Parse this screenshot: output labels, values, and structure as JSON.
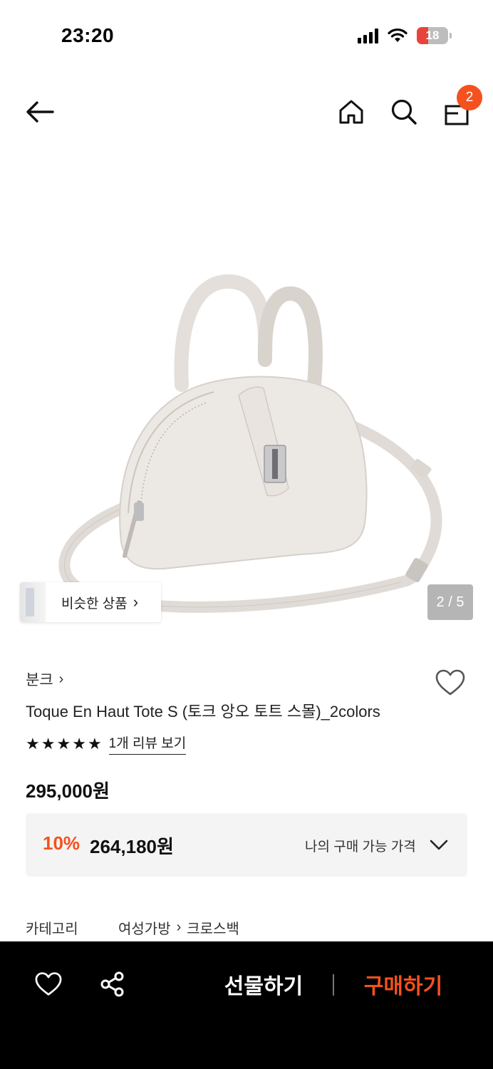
{
  "status_bar": {
    "time": "23:20",
    "battery_level": "18",
    "icons": [
      "cellular-signal-icon",
      "wifi-icon",
      "battery-icon"
    ]
  },
  "top_nav": {
    "icons": [
      "back-arrow-icon",
      "home-icon",
      "search-icon",
      "shopping-bag-icon"
    ],
    "cart_count": "2"
  },
  "gallery": {
    "similar_products_label": "비슷한 상품",
    "current_page": "2",
    "total_pages": "5",
    "page_indicator": "2 / 5"
  },
  "product": {
    "brand": "분크",
    "title": "Toque En Haut Tote S (토크 앙오 토트 스몰)_2colors",
    "rating_stars": 5,
    "review_link": "1개 리뷰 보기",
    "original_price": "295,000원",
    "discount_rate": "10%",
    "sale_price": "264,180원",
    "my_price_label": "나의 구매 가능 가격"
  },
  "category": {
    "label": "카테고리",
    "path": [
      "여성가방",
      "크로스백"
    ]
  },
  "bottom_bar": {
    "gift_label": "선물하기",
    "buy_label": "구매하기",
    "icons": [
      "heart-icon",
      "share-icon"
    ]
  },
  "colors": {
    "accent": "#f4511e",
    "bottom_bar_bg": "#000000",
    "price_box_bg": "#f4f4f4"
  }
}
